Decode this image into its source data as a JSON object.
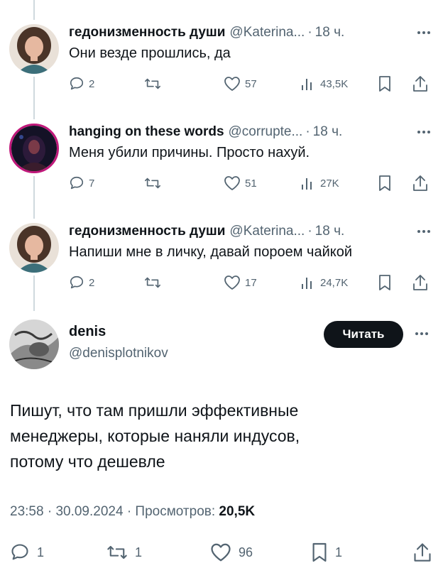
{
  "replies": [
    {
      "name": "гедонизменность души",
      "handle": "@Katerina...",
      "dot": "·",
      "time": "18 ч.",
      "text": "Они везде прошлись, да",
      "replies": "2",
      "likes": "57",
      "views": "43,5K"
    },
    {
      "name": "hanging on these words",
      "handle": "@corrupte...",
      "dot": "·",
      "time": "18 ч.",
      "text": "Меня убили причины. Просто нахуй.",
      "replies": "7",
      "likes": "51",
      "views": "27K"
    },
    {
      "name": "гедонизменность души",
      "handle": "@Katerina...",
      "dot": "·",
      "time": "18 ч.",
      "text": "Напиши мне в личку, давай пороем чайкой",
      "replies": "2",
      "likes": "17",
      "views": "24,7K"
    }
  ],
  "main": {
    "name": "denis",
    "handle": "@denisplotnikov",
    "follow_label": "Читать",
    "text_lines": [
      "Пишут, что там пришли эффективные",
      "менеджеры, которые наняли индусов,",
      "потому что дешевле"
    ],
    "time": "23:58",
    "date": "30.09.2024",
    "views_label": "Просмотров:",
    "views": "20,5K",
    "replies": "1",
    "retweets": "1",
    "likes": "96",
    "bookmarks": "1"
  },
  "icons": {
    "more": "more-dots-icon",
    "reply": "reply-bubble-icon",
    "retweet": "retweet-icon",
    "like": "heart-icon",
    "views": "bar-chart-icon",
    "bookmark": "bookmark-icon",
    "share": "share-icon"
  },
  "colors": {
    "text": "#0f1419",
    "secondary": "#536471",
    "line": "#cfd9de",
    "button_bg": "#0f1419",
    "button_text": "#ffffff",
    "avatar_ring": "#c0187a"
  }
}
